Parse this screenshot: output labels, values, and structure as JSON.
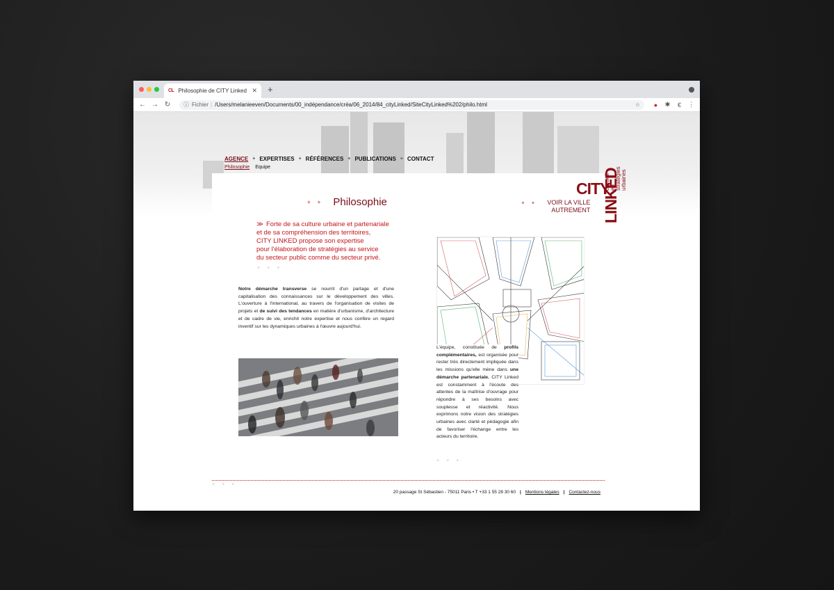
{
  "browser": {
    "tab_title": "Philosophie de CITY Linked",
    "favicon_text": "CL",
    "address_scheme": "Fichier",
    "url": "/Users/melanieeven/Documents/00_indépendance/créa/06_2014/84_cityLinked/SiteCityLinked%202/philo.html"
  },
  "nav": {
    "items": [
      {
        "label": "AGENCE",
        "active": true
      },
      {
        "label": "EXPERTISES"
      },
      {
        "label": "RÉFÉRENCES"
      },
      {
        "label": "PUBLICATIONS"
      },
      {
        "label": "CONTACT"
      }
    ],
    "sub_items": [
      {
        "label": "Philosophie",
        "active": true
      },
      {
        "label": "Equipe"
      }
    ]
  },
  "logo": {
    "city": "CITY",
    "linked": "LINKED",
    "tagline_1": "conseil",
    "tagline_2": "en stratégies",
    "tagline_3": "urbaines"
  },
  "main": {
    "title": "Philosophie",
    "voir_line1": "VOIR LA VILLE",
    "voir_line2": "AUTREMENT",
    "intro_line1": "Forte de sa culture urbaine et partenariale",
    "intro_line2": "et de sa compréhension des territoires,",
    "intro_line3": "CITY LINKED propose son expertise",
    "intro_line4": "pour l'élaboration de stratégies au service",
    "intro_line5": "du secteur public comme du secteur privé.",
    "para1_b1": "Notre démarche transverse",
    "para1_t1": " se nourrit d'un partage et d'une capitalisation des connaissances sur le développement des villes. L'ouverture à l'international, au travers de l'organisation de visites de projets et ",
    "para1_b2": "de suivi des tendances",
    "para1_t2": " en matière d'urbanisme, d'architecture et de cadre de vie, enrichit notre expertise et nous confère un regard inventif sur les dynamiques urbaines à l'œuvre aujourd'hui.",
    "para2_t1": "L'équipe, constituée de ",
    "para2_b1": "profils complémentaires,",
    "para2_t2": " est organisée pour rester très directement impliquée dans les missions qu'elle mène dans ",
    "para2_b2": "une démarche partenariale.",
    "para2_t3": " CITY Linked est constamment à l'écoute des attentes de la maîtrise d'ouvrage pour répondre à ses besoins avec souplesse et réactivité. Nous exprimons notre vision des stratégies urbaines avec clarté et pédagogie afin de favoriser l'échange entre les acteurs du territoire."
  },
  "footer": {
    "address": "20 passage St Sébastien - 75011 Paris • T +33 1 55 28 30 60",
    "legal": "Mentions légales",
    "contact": "Contactez-nous"
  },
  "colors": {
    "brand": "#8b0e16",
    "accent": "#c4161c"
  }
}
